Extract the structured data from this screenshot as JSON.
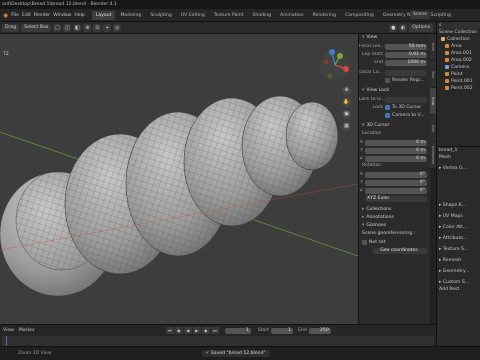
{
  "window": {
    "title": "ard\\Desktop\\Bread 1\\bread 12.blend - Blender 4.1"
  },
  "menu": [
    "File",
    "Edit",
    "Render",
    "Window",
    "Help"
  ],
  "workspaces": [
    "Layout",
    "Modeling",
    "Sculpting",
    "UV Editing",
    "Texture Paint",
    "Shading",
    "Animation",
    "Rendering",
    "Compositing",
    "Geometry Nodes",
    "Scripting"
  ],
  "workspace_active": "Layout",
  "scene_label": "Scene",
  "header": {
    "mode_label": "Drag",
    "select_mode": "Select Box",
    "view_menu": [
      "View",
      "Select",
      "Add",
      "Object"
    ],
    "global_label": "GIS",
    "options": "Options"
  },
  "viewport": {
    "corner_label": "72"
  },
  "npanel": {
    "view_section": "View",
    "focal_length_label": "Focal Len...",
    "focal_length_value": "50 mm",
    "clip_start_label": "Clip Start",
    "clip_start_value": "0.01 m",
    "clip_end_label": "End",
    "clip_end_value": "1000 m",
    "local_camera_label": "Local Ca...",
    "render_region_label": "Render Regi...",
    "view_lock_section": "View Lock",
    "lock_to_object_label": "Lock to O...",
    "lock_label": "Lock",
    "to_3d_cursor": "To 3D Cursor",
    "camera_to_view": "Camera to V...",
    "cursor_section": "3D Cursor",
    "location_label": "Location",
    "loc_x": "0 m",
    "loc_y": "0 m",
    "loc_z": "0 m",
    "rotation_label": "Rotation",
    "rot_x": "0°",
    "rot_y": "0°",
    "rot_z": "0°",
    "rotation_mode": "XYZ Euler",
    "collections_section": "Collections",
    "annotations_section": "Annotations",
    "gizmos_section": "Gizmoes",
    "georef_label": "Scene georeferencing :",
    "not_set": "Not set",
    "geo_coords_button": "Geo coordinates"
  },
  "ntabs": [
    "Item",
    "Tool",
    "View",
    "Edit",
    "Animation"
  ],
  "outliner": {
    "title": "Scene Collection",
    "rows": [
      {
        "name": "Collection",
        "color": "#e0b060"
      },
      {
        "name": "Area",
        "color": "#d08a3a"
      },
      {
        "name": "Area.001",
        "color": "#d08a3a"
      },
      {
        "name": "Area.002",
        "color": "#d08a3a"
      },
      {
        "name": "Camera",
        "color": "#6f9de0"
      },
      {
        "name": "Point",
        "color": "#d08a3a"
      },
      {
        "name": "Point.001",
        "color": "#d08a3a"
      },
      {
        "name": "Point.002",
        "color": "#d08a3a"
      }
    ]
  },
  "properties": {
    "object_name": "bread_1",
    "mesh_label": "Mesh",
    "sections": [
      "Vertex G...",
      "Shape K...",
      "UV Maps",
      "Color Att...",
      "Attribute...",
      "Texture S...",
      "Remesh",
      "Geometry...",
      "Custom S..."
    ],
    "add_rest_label": "Add Rest"
  },
  "timeline": {
    "view_label": "View",
    "marker_label": "Marker",
    "current_frame": "1",
    "start_label": "Start",
    "start_frame": "1",
    "end_label": "End",
    "end_frame": "250"
  },
  "status": {
    "left": "Zoom 2D View",
    "saved_message": "Saved \"bread 12.blend\""
  },
  "colors": {
    "accent": "#4772b3",
    "viewport_bg": "#3d3d3d",
    "x_axis": "#d1493e",
    "y_axis": "#7ca735",
    "z_axis": "#3f7ed6"
  }
}
